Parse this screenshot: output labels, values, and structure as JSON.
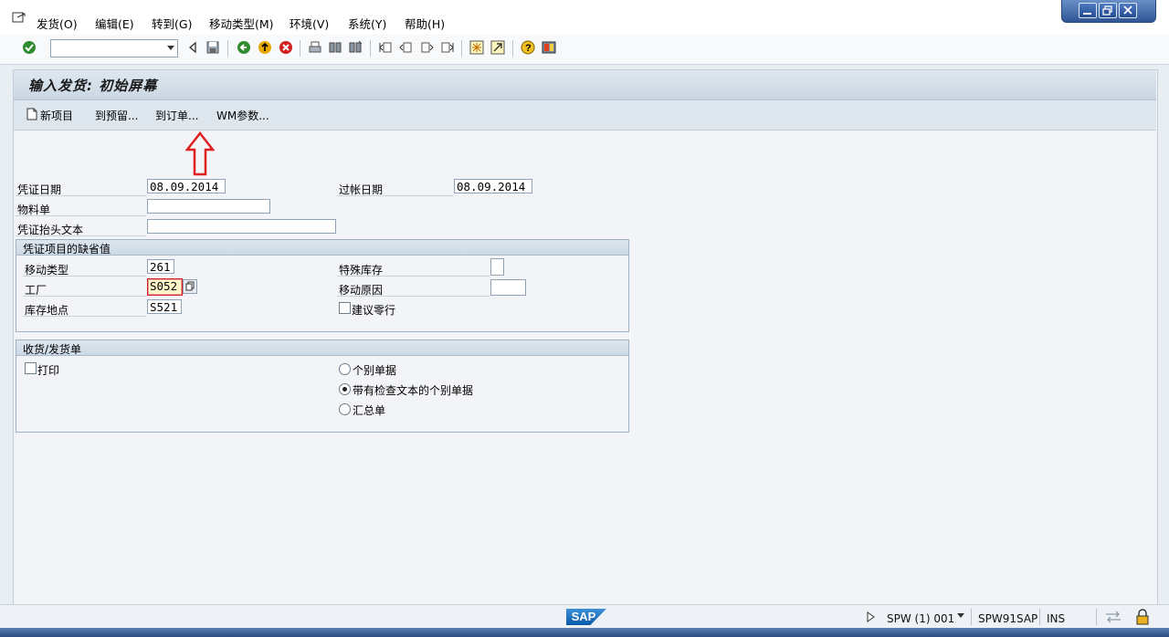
{
  "menu": {
    "items": [
      "发货(O)",
      "编辑(E)",
      "转到(G)",
      "移动类型(M)",
      "环境(V)",
      "系统(Y)",
      "帮助(H)"
    ]
  },
  "window_controls": [
    "minimize-icon",
    "restore-icon",
    "close-icon"
  ],
  "toolbar": {
    "command_field_value": "",
    "icons": [
      "check-icon",
      "back-arrow-icon",
      "save-icon",
      "back-icon",
      "exit-icon",
      "cancel-icon",
      "print-icon",
      "find-icon",
      "find-next-icon",
      "first-page-icon",
      "prev-page-icon",
      "next-page-icon",
      "last-page-icon",
      "new-session-icon",
      "shortcut-icon",
      "help-icon",
      "customize-icon"
    ]
  },
  "screen": {
    "title": "输入发货: 初始屏幕"
  },
  "app_toolbar": {
    "new_item": "新项目",
    "to_reservation": "到预留...",
    "to_order": "到订单...",
    "wm_params": "WM参数..."
  },
  "header": {
    "doc_date_label": "凭证日期",
    "doc_date_value": "08.09.2014",
    "posting_date_label": "过帐日期",
    "posting_date_value": "08.09.2014",
    "material_slip_label": "物料单",
    "material_slip_value": "",
    "header_text_label": "凭证抬头文本",
    "header_text_value": ""
  },
  "defaults_group": {
    "title": "凭证项目的缺省值",
    "movement_type_label": "移动类型",
    "movement_type_value": "261",
    "plant_label": "工厂",
    "plant_value": "S052",
    "storage_loc_label": "库存地点",
    "storage_loc_value": "S521",
    "special_stock_label": "特殊库存",
    "special_stock_value": "",
    "reason_label": "移动原因",
    "reason_value": "",
    "suggest_zero_label": "建议零行",
    "suggest_zero_checked": false
  },
  "gr_gi_slip_group": {
    "title": "收货/发货单",
    "print_label": "打印",
    "print_checked": false,
    "options": [
      "个别单据",
      "带有检查文本的个别单据",
      "汇总单"
    ],
    "selected_index": 1
  },
  "status_bar": {
    "logo": "SAP",
    "session": "SPW (1) 001",
    "server": "SPW91SAP",
    "mode": "INS"
  },
  "colors": {
    "title_bar": "#c9d6e2",
    "arrow_annotation": "#e02020",
    "focus_border": "#d22020"
  }
}
